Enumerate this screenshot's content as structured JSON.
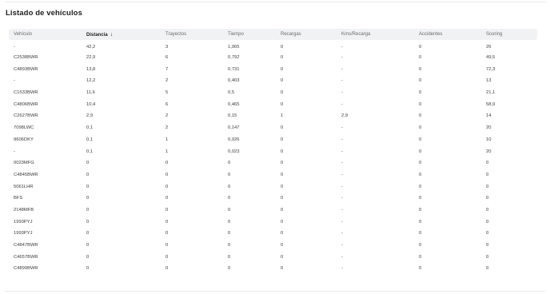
{
  "page": {
    "title": "Listado de vehículos"
  },
  "table": {
    "sort_icon": "arrow-down-icon",
    "sort_glyph": "↓",
    "columns": [
      "Vehículo",
      "Distancia",
      "Trayectos",
      "Tiempo",
      "Recargas",
      "Kms/Recarga",
      "Accidentes",
      "Scoring"
    ],
    "rows": [
      [
        "-",
        "42,2",
        "3",
        "1,065",
        "0",
        "-",
        "0",
        "26"
      ],
      [
        "C2538BWR",
        "22,9",
        "6",
        "0,792",
        "0",
        "-",
        "0",
        "49,5"
      ],
      [
        "C4893BWR",
        "13,8",
        "7",
        "0,731",
        "0",
        "-",
        "0",
        "72,3"
      ],
      [
        "-",
        "12,2",
        "2",
        "0,403",
        "0",
        "-",
        "0",
        "13"
      ],
      [
        "C1533BWR",
        "11,6",
        "5",
        "0,5",
        "0",
        "-",
        "0",
        "21,1"
      ],
      [
        "C4806BWR",
        "10,4",
        "6",
        "0,465",
        "0",
        "-",
        "0",
        "58,9"
      ],
      [
        "C2627BWR",
        "2,9",
        "2",
        "0,15",
        "1",
        "2,9",
        "0",
        "14"
      ],
      [
        "7098LWC",
        "0,1",
        "2",
        "0,147",
        "0",
        "-",
        "0",
        "20"
      ],
      [
        "9606DKY",
        "0,1",
        "1",
        "0,026",
        "0",
        "-",
        "0",
        "10"
      ],
      [
        "-",
        "0,1",
        "1",
        "0,023",
        "0",
        "-",
        "0",
        "20"
      ],
      [
        "0023MFG",
        "0",
        "0",
        "0",
        "0",
        "-",
        "0",
        "0"
      ],
      [
        "C4845BWR",
        "0",
        "0",
        "0",
        "0",
        "-",
        "0",
        "0"
      ],
      [
        "5061LHR",
        "0",
        "0",
        "0",
        "0",
        "-",
        "0",
        "0"
      ],
      [
        "BFS",
        "0",
        "0",
        "0",
        "0",
        "-",
        "0",
        "0"
      ],
      [
        "2148MFB",
        "0",
        "0",
        "0",
        "0",
        "-",
        "0",
        "0"
      ],
      [
        "1993PYJ",
        "0",
        "0",
        "0",
        "0",
        "-",
        "0",
        "0"
      ],
      [
        "1993PYJ",
        "0",
        "0",
        "0",
        "0",
        "-",
        "0",
        "0"
      ],
      [
        "C4847BWR",
        "0",
        "0",
        "0",
        "0",
        "-",
        "0",
        "0"
      ],
      [
        "C4657BWR",
        "0",
        "0",
        "0",
        "0",
        "-",
        "0",
        "0"
      ],
      [
        "C4899BWR",
        "0",
        "0",
        "0",
        "0",
        "-",
        "0",
        "0"
      ]
    ]
  }
}
